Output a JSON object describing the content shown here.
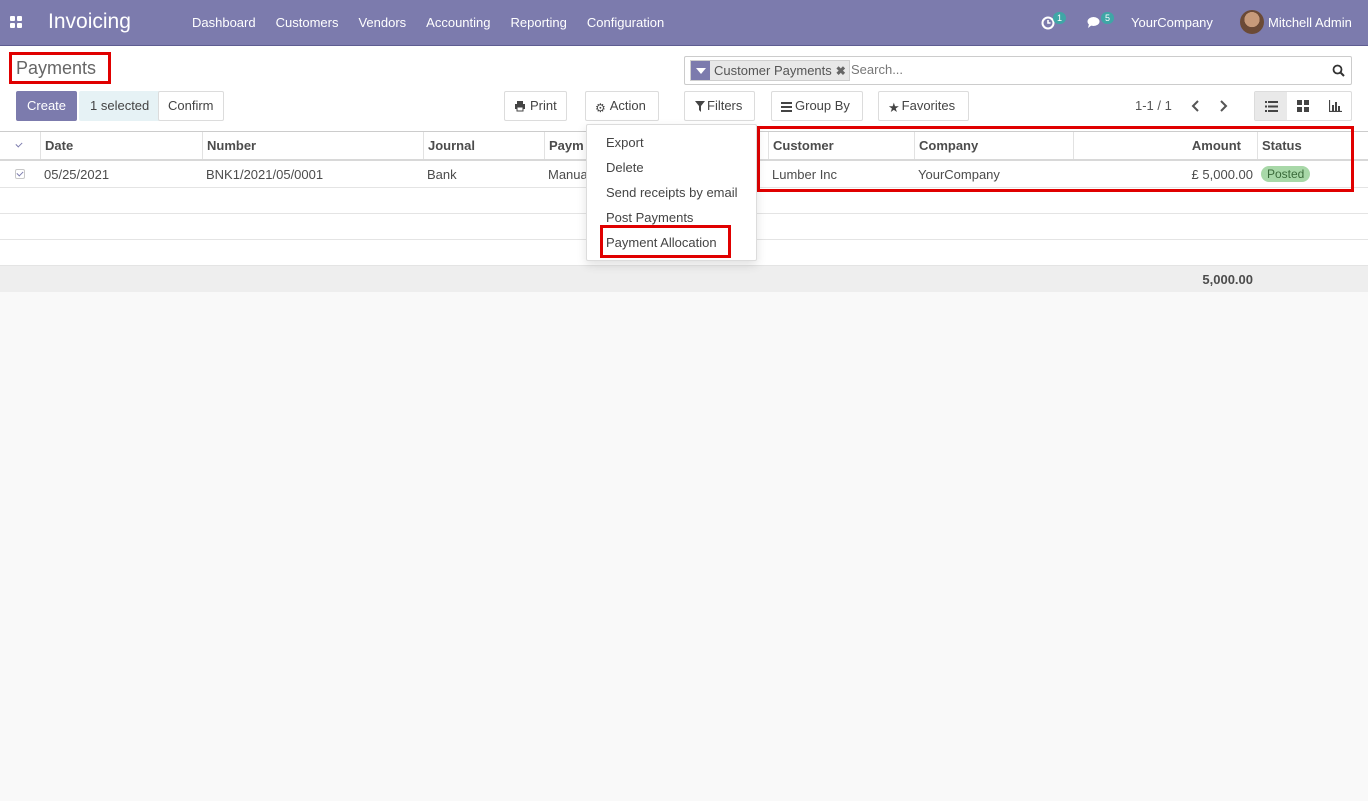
{
  "navbar": {
    "app_title": "Invoicing",
    "menu": [
      "Dashboard",
      "Customers",
      "Vendors",
      "Accounting",
      "Reporting",
      "Configuration"
    ],
    "activity_count": "1",
    "messages_count": "5",
    "company": "YourCompany",
    "user": "Mitchell Admin",
    "colors": {
      "navbar": "#7c7bad",
      "badge": "#3fa6a6"
    }
  },
  "control_panel": {
    "title": "Payments",
    "search": {
      "facet_label": "Customer Payments",
      "placeholder": "Search..."
    },
    "buttons": {
      "create": "Create",
      "selected": "1 selected",
      "confirm": "Confirm",
      "print": "Print",
      "action": "Action",
      "filters": "Filters",
      "group_by": "Group By",
      "favorites": "Favorites"
    },
    "pager": "1-1 / 1",
    "views": [
      "list-icon",
      "kanban-icon",
      "graph-icon"
    ]
  },
  "action_menu": {
    "items": [
      "Export",
      "Delete",
      "Send receipts by email",
      "Post Payments",
      "Payment Allocation"
    ]
  },
  "table": {
    "columns": [
      "Date",
      "Number",
      "Journal",
      "Paym",
      "Customer",
      "Company",
      "Amount",
      "Status"
    ],
    "rows": [
      {
        "date": "05/25/2021",
        "number": "BNK1/2021/05/0001",
        "journal": "Bank",
        "payment_method": "Manua",
        "customer": "Lumber Inc",
        "company": "YourCompany",
        "amount": "£ 5,000.00",
        "status": "Posted"
      }
    ],
    "total_amount": "5,000.00"
  }
}
